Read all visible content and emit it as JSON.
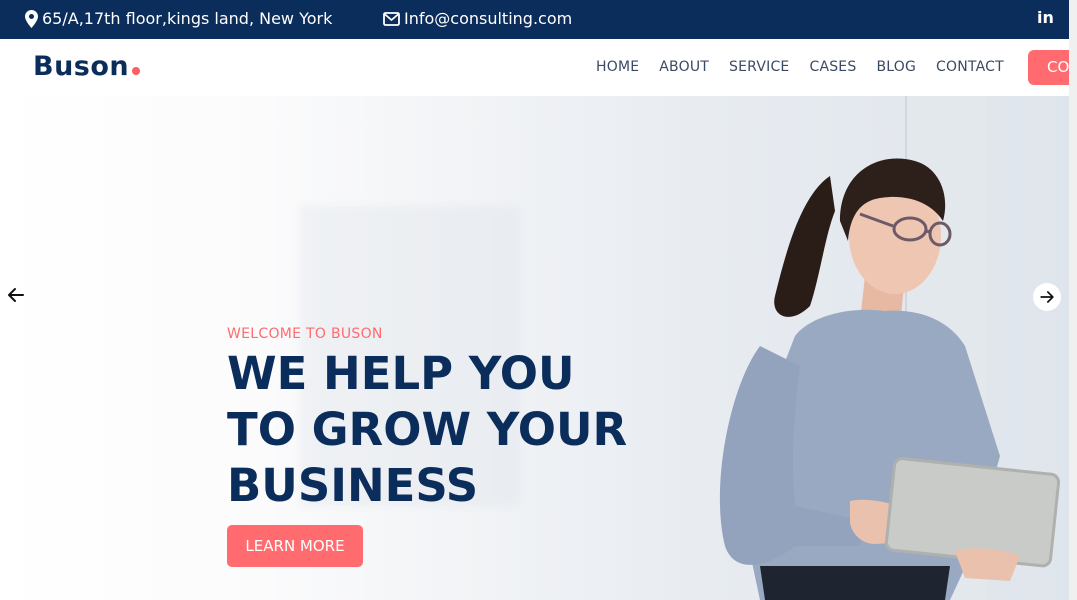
{
  "topbar": {
    "address": "65/A,17th floor,kings land, New York",
    "email": "Info@consulting.com",
    "social_label": "in",
    "address_icon": "map-pin-icon",
    "email_icon": "envelope-icon"
  },
  "header": {
    "logo_text": "Buson",
    "nav": [
      "HOME",
      "ABOUT",
      "SERVICE",
      "CASES",
      "BLOG",
      "CONTACT"
    ],
    "cta_label": "CO"
  },
  "hero": {
    "welcome": "WELCOME TO BUSON",
    "headline": [
      "WE HELP YOU",
      "TO GROW YOUR",
      "BUSINESS"
    ],
    "button_label": "LEARN MORE"
  },
  "colors": {
    "navy": "#0b2d5b",
    "accent": "#ff6b6f"
  }
}
